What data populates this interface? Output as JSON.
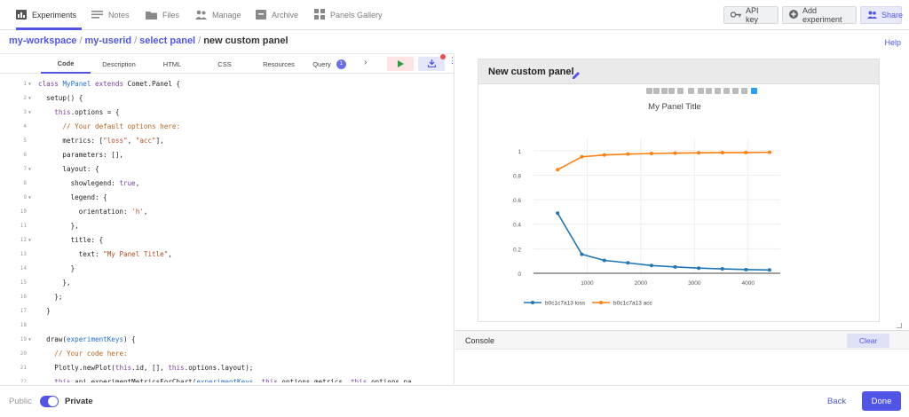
{
  "nav": {
    "items": [
      {
        "label": "Experiments",
        "icon": "bar-chart-icon"
      },
      {
        "label": "Notes",
        "icon": "lines-icon"
      },
      {
        "label": "Files",
        "icon": "folder-icon"
      },
      {
        "label": "Manage",
        "icon": "users-icon"
      },
      {
        "label": "Archive",
        "icon": "archive-icon"
      },
      {
        "label": "Panels Gallery",
        "icon": "grid-icon"
      }
    ],
    "api_key": "API key",
    "add_experiment": "Add experiment",
    "share": "Share"
  },
  "breadcrumb": {
    "workspace": "my-workspace",
    "user": "my-userid",
    "select": "select panel",
    "current": "new custom panel"
  },
  "help": "Help",
  "editor": {
    "tabs": [
      "Code",
      "Description",
      "HTML",
      "CSS",
      "Resources",
      "Query"
    ],
    "query_badge": "1",
    "lines": [
      {
        "n": "1",
        "fold": true,
        "html": "<span class=\"kw\">class</span> <span class=\"cls\">MyPanel</span> <span class=\"kw\">extends</span> Comet.Panel {"
      },
      {
        "n": "2",
        "fold": true,
        "html": "  setup() {"
      },
      {
        "n": "3",
        "fold": true,
        "html": "    <span class=\"kw\">this</span>.options = {"
      },
      {
        "n": "4",
        "fold": false,
        "html": "      <span class=\"cm\">// Your default options here:</span>"
      },
      {
        "n": "5",
        "fold": false,
        "html": "      metrics: [<span class=\"str\">\"loss\"</span>, <span class=\"str\">\"acc\"</span>],"
      },
      {
        "n": "6",
        "fold": false,
        "html": "      parameters: [],"
      },
      {
        "n": "7",
        "fold": true,
        "html": "      layout: {"
      },
      {
        "n": "8",
        "fold": false,
        "html": "        showlegend: <span class=\"kw\">true</span>,"
      },
      {
        "n": "9",
        "fold": true,
        "html": "        legend: {"
      },
      {
        "n": "10",
        "fold": false,
        "html": "          orientation: <span class=\"str\">'h'</span>,"
      },
      {
        "n": "11",
        "fold": false,
        "html": "        },"
      },
      {
        "n": "12",
        "fold": true,
        "html": "        title: {"
      },
      {
        "n": "13",
        "fold": false,
        "html": "          text: <span class=\"str\">\"My Panel Title\"</span>,"
      },
      {
        "n": "14",
        "fold": false,
        "html": "        }"
      },
      {
        "n": "15",
        "fold": false,
        "html": "      },"
      },
      {
        "n": "16",
        "fold": false,
        "html": "    };"
      },
      {
        "n": "17",
        "fold": false,
        "html": "  }"
      },
      {
        "n": "18",
        "fold": false,
        "html": ""
      },
      {
        "n": "19",
        "fold": true,
        "html": "  draw(<span class=\"cls\">experimentKeys</span>) {"
      },
      {
        "n": "20",
        "fold": false,
        "html": "    <span class=\"cm\">// Your code here:</span>"
      },
      {
        "n": "21",
        "fold": false,
        "html": "    Plotly.newPlot(<span class=\"kw\">this</span>.id, [], <span class=\"kw\">this</span>.options.layout);"
      },
      {
        "n": "22",
        "fold": false,
        "html": "    <span class=\"kw\">this</span>.api.experimentMetricsForChart(<span class=\"cls\">experimentKeys</span>, <span class=\"kw\">this</span>.options.metrics, <span class=\"kw\">this</span>.options.pa"
      }
    ]
  },
  "preview": {
    "title": "New custom panel"
  },
  "chart_data": {
    "type": "line",
    "title": "My Panel Title",
    "xlabel": "",
    "ylabel": "",
    "xlim": [
      0,
      4600
    ],
    "ylim": [
      0,
      1.1
    ],
    "xticks": [
      1000,
      2000,
      3000,
      4000
    ],
    "yticks": [
      0,
      0.2,
      0.4,
      0.6,
      0.8,
      1
    ],
    "legend": "bottom-left",
    "grid": true,
    "series": [
      {
        "name": "b0c1c7a13 loss",
        "color": "#1f77b4",
        "x": [
          450,
          900,
          1320,
          1760,
          2200,
          2640,
          3080,
          3520,
          3960,
          4400
        ],
        "y": [
          0.49,
          0.155,
          0.105,
          0.085,
          0.063,
          0.052,
          0.042,
          0.036,
          0.03,
          0.027
        ]
      },
      {
        "name": "b0c1c7a13 acc",
        "color": "#ff7f0e",
        "x": [
          450,
          900,
          1320,
          1760,
          2200,
          2640,
          3080,
          3520,
          3960,
          4400
        ],
        "y": [
          0.845,
          0.95,
          0.965,
          0.972,
          0.977,
          0.98,
          0.982,
          0.984,
          0.985,
          0.987
        ]
      }
    ]
  },
  "console": {
    "label": "Console",
    "clear": "Clear"
  },
  "footer": {
    "public": "Public",
    "private": "Private",
    "back": "Back",
    "done": "Done"
  }
}
